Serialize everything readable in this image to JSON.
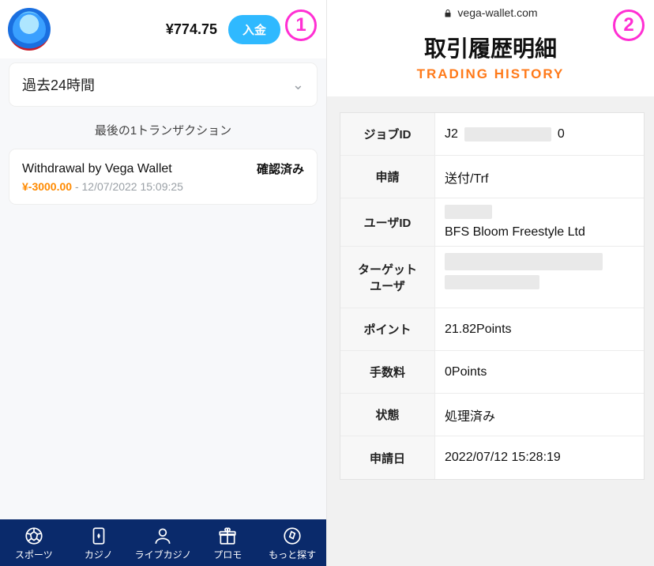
{
  "badges": {
    "one": "1",
    "two": "2"
  },
  "left": {
    "balance": "¥774.75",
    "deposit_label": "入金",
    "filter_label": "過去24時間",
    "last_txn_label": "最後の1トランザクション",
    "txn": {
      "title": "Withdrawal by Vega Wallet",
      "status": "確認済み",
      "amount": "¥-3000.00",
      "sep": " - ",
      "datetime": "12/07/2022 15:09:25"
    },
    "nav": {
      "sports": "スポーツ",
      "casino": "カジノ",
      "livecasino": "ライブカジノ",
      "promo": "プロモ",
      "more": "もっと探す"
    }
  },
  "right": {
    "url": "vega-wallet.com",
    "title": "取引履歴明細",
    "subtitle": "TRADING HISTORY",
    "rows": {
      "job_id": {
        "label": "ジョブID",
        "prefix": "J2",
        "suffix": "0"
      },
      "request": {
        "label": "申請",
        "value": "送付/Trf"
      },
      "user_id": {
        "label": "ユーザID",
        "value": "BFS Bloom Freestyle Ltd"
      },
      "target_user": {
        "label_line1": "ターゲット",
        "label_line2": "ユーザ"
      },
      "points": {
        "label": "ポイント",
        "value": "21.82Points"
      },
      "fee": {
        "label": "手数料",
        "value": "0Points"
      },
      "status": {
        "label": "状態",
        "value": "処理済み"
      },
      "applied": {
        "label": "申請日",
        "value": "2022/07/12 15:28:19"
      }
    }
  }
}
